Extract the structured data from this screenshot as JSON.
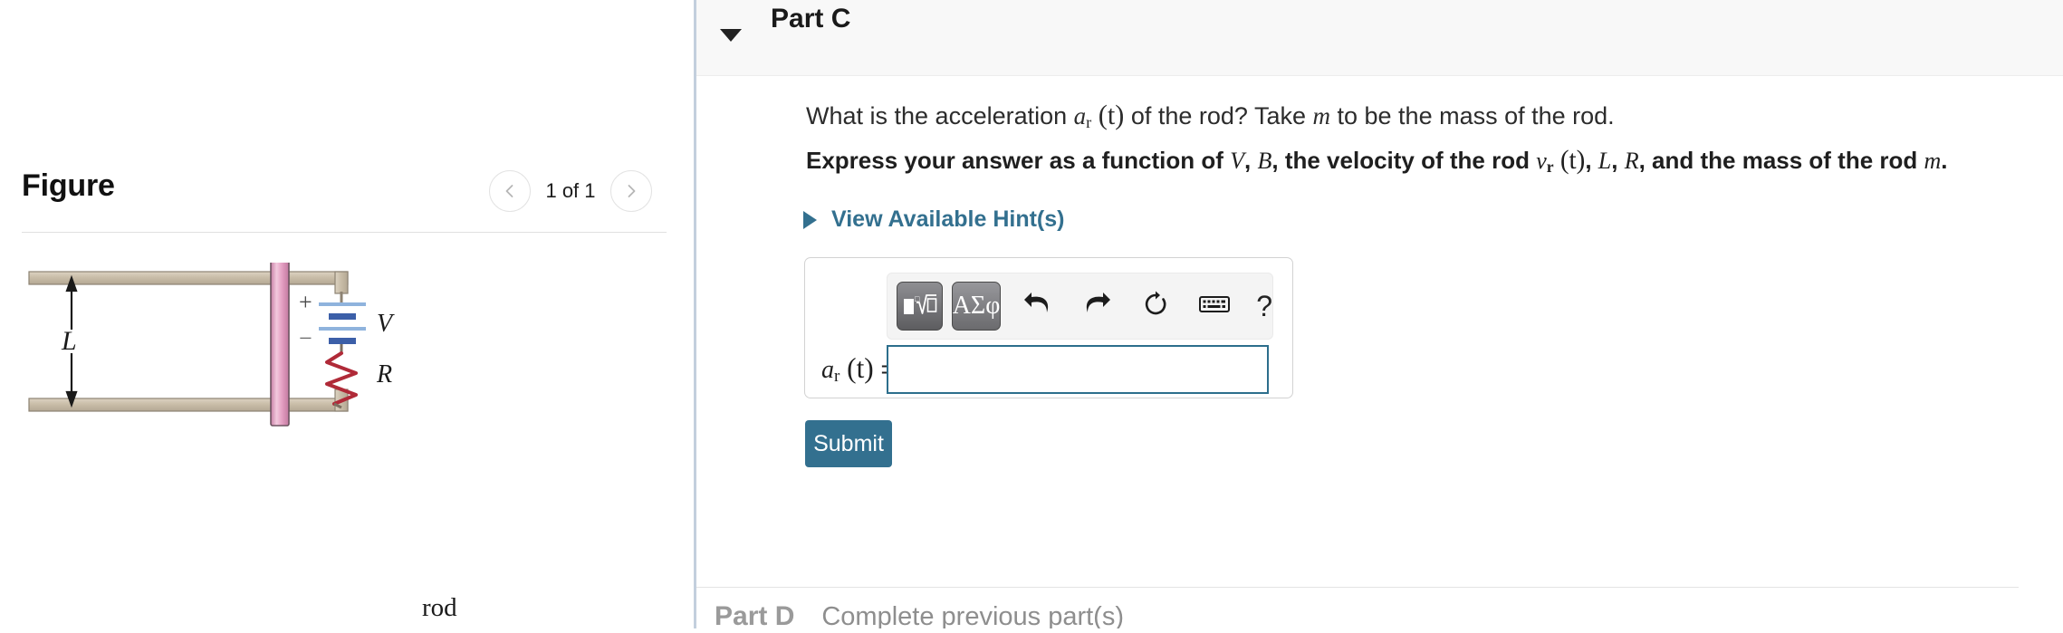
{
  "figure_panel": {
    "title": "Figure",
    "pager": {
      "prev_icon": "chevron-left-icon",
      "next_icon": "chevron-right-icon",
      "label": "1 of 1",
      "current": 1,
      "total": 1
    },
    "diagram": {
      "rail_color": "#c9bda8",
      "rod_color": "#e6a8c8",
      "resistor_color": "#b02a38",
      "battery_color": "#3c5fa8",
      "labels": {
        "length": "L",
        "voltage": "V",
        "resistance": "R",
        "rod": "rod",
        "battery_plus": "+",
        "battery_minus": "−"
      }
    }
  },
  "part": {
    "caret_icon": "caret-down-icon",
    "title": "Part C",
    "question": {
      "text_1": "What is the acceleration ",
      "math_a": "a",
      "math_a_sub": "r",
      "math_t": "(t)",
      "text_2": " of the rod? Take ",
      "math_m": "m",
      "text_3": " to be the mass of the rod."
    },
    "instruction": {
      "text_1": "Express your answer as a function of ",
      "math_V": "V",
      "sep_1": ", ",
      "math_B": "B",
      "text_2": ", the velocity of the rod ",
      "math_v": "v",
      "math_v_sub": "r",
      "math_vt": "(t)",
      "sep_2": ", ",
      "math_L": "L",
      "sep_3": ", ",
      "math_R": "R",
      "text_3": ", and the mass of the rod ",
      "math_m": "m",
      "period": "."
    },
    "hints_link": {
      "label": "View Available Hint(s)",
      "icon": "triangle-right-icon",
      "color": "#33708f"
    },
    "answer": {
      "label_a": "a",
      "label_sub": "r",
      "label_t": "(t)",
      "label_eq": "=",
      "value": "",
      "placeholder": ""
    },
    "math_toolbar": {
      "buttons": [
        {
          "name": "template-sqrt-button",
          "label": "√",
          "icon": "template-sqrt-icon"
        },
        {
          "name": "greek-symbols-button",
          "label": "ΑΣφ",
          "icon": "greek-letters-icon"
        },
        {
          "name": "undo-button",
          "label": "",
          "icon": "undo-arrow-icon"
        },
        {
          "name": "redo-button",
          "label": "",
          "icon": "redo-arrow-icon"
        },
        {
          "name": "reset-button",
          "label": "",
          "icon": "reset-circular-arrow-icon"
        },
        {
          "name": "keyboard-button",
          "label": "",
          "icon": "keyboard-icon"
        },
        {
          "name": "help-button",
          "label": "?",
          "icon": "question-mark-icon"
        }
      ]
    },
    "submit_label": "Submit"
  },
  "next_part": {
    "title": "Part D",
    "status": "Complete previous part(s)"
  },
  "colors": {
    "accent": "#33708f",
    "input_border": "#2c6e8c",
    "header_bg": "#f8f8f8",
    "divider": "#c3cfdd"
  }
}
